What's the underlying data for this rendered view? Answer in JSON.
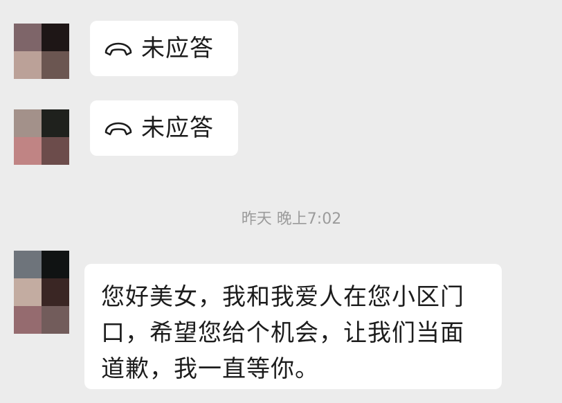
{
  "messages": [
    {
      "type": "call",
      "status_text": "未应答",
      "icon": "phone-hangup-icon"
    },
    {
      "type": "call",
      "status_text": "未应答",
      "icon": "phone-hangup-icon"
    },
    {
      "type": "text",
      "text": "您好美女，我和我爱人在您小区门口，希望您给个机会，让我们当面道歉，我一直等你。"
    }
  ],
  "timestamp": "昨天 晚上7:02",
  "avatars": {
    "first": [
      "#7e6569",
      "#1e1616",
      "#bba198",
      "#6b5651"
    ],
    "second": [
      "#a3918a",
      "#1f211d",
      "#c08484",
      "#6c4c4b"
    ],
    "third": [
      "#6e747b",
      "#101313",
      "#c3aca1",
      "#3a2624",
      "#956b6f",
      "#725c5b"
    ]
  },
  "colors": {
    "background": "#ececec",
    "bubble": "#ffffff",
    "timestamp": "#9b9b9b"
  }
}
